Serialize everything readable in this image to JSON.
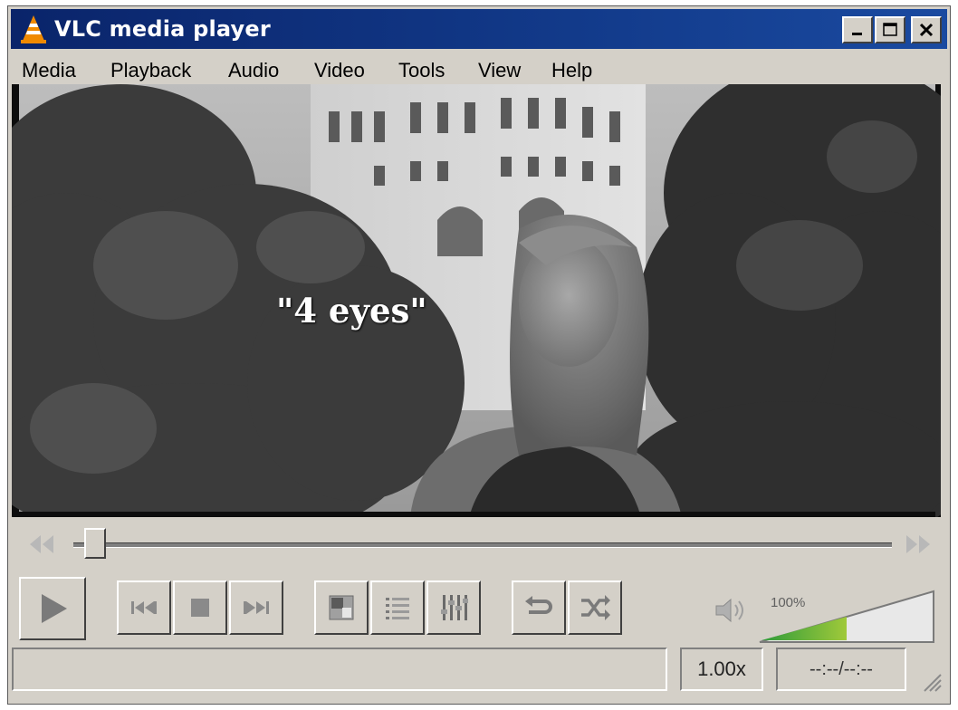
{
  "window": {
    "title": "VLC media player",
    "controls": [
      "minimize-icon",
      "maximize-icon",
      "close-icon"
    ]
  },
  "menu": {
    "items": [
      "Media",
      "Playback",
      "Audio",
      "Video",
      "Tools",
      "View",
      "Help"
    ]
  },
  "video": {
    "subtitle": "\"4 eyes\""
  },
  "seek": {
    "position_fraction": 0.02
  },
  "controls": {
    "play": "play-icon",
    "previous": "previous-icon",
    "stop": "stop-icon",
    "next": "next-icon",
    "fullscreen": "fullscreen-icon",
    "playlist": "playlist-icon",
    "extended_settings": "equalizer-icon",
    "loop": "loop-icon",
    "shuffle": "shuffle-icon"
  },
  "volume": {
    "label": "100%",
    "level_fraction": 0.5
  },
  "status": {
    "text": "",
    "playback_rate": "1.00x",
    "time": "--:--/--:--"
  },
  "colors": {
    "titlebar": "#0a246a",
    "window_face": "#d4d0c8",
    "volume_low": "#2e9b3a",
    "volume_high": "#f2a020"
  }
}
